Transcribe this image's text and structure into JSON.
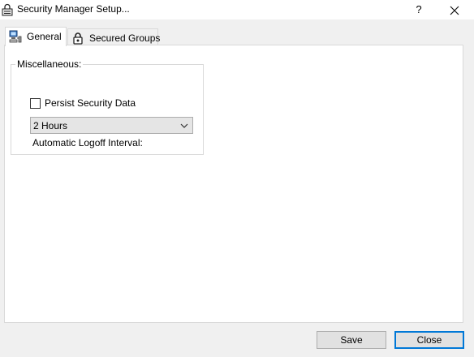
{
  "window": {
    "title": "Security Manager Setup...",
    "help_label": "?",
    "icon": "lock-printer-icon"
  },
  "tabs": [
    {
      "label": "General",
      "icon": "computer-network-icon",
      "active": true
    },
    {
      "label": "Secured Groups",
      "icon": "padlock-icon",
      "active": false
    }
  ],
  "general": {
    "group_title": "Miscellaneous:",
    "persist_label": "Persist Security Data",
    "persist_checked": false,
    "interval_value": "2 Hours",
    "interval_label": "Automatic Logoff Interval:"
  },
  "buttons": {
    "save": "Save",
    "close": "Close"
  },
  "colors": {
    "accent": "#0078d7",
    "panel": "#ffffff",
    "background": "#f0f0f0"
  }
}
